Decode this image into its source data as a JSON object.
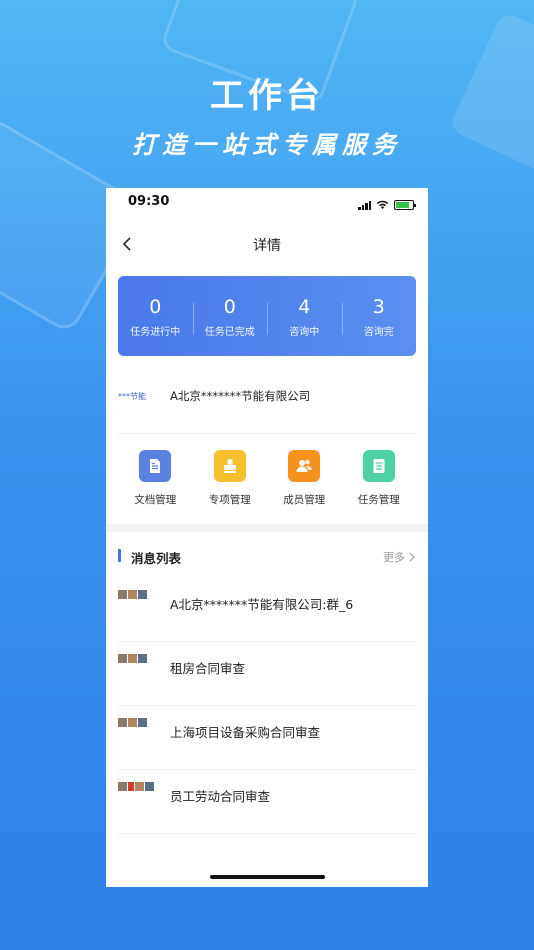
{
  "hero": {
    "title": "工作台",
    "subtitle": "打造一站式专属服务"
  },
  "statusbar": {
    "time": "09:30"
  },
  "navbar": {
    "title": "详情"
  },
  "stats": [
    {
      "value": "0",
      "label": "任务进行中"
    },
    {
      "value": "0",
      "label": "任务已完成"
    },
    {
      "value": "4",
      "label": "咨询中"
    },
    {
      "value": "3",
      "label": "咨询完"
    }
  ],
  "company": {
    "logo_text": "***节能",
    "name": "A北京*******节能有限公司"
  },
  "menu": [
    {
      "label": "文档管理",
      "icon": "document-icon",
      "color": "#5b82e3"
    },
    {
      "label": "专项管理",
      "icon": "stamp-icon",
      "color": "#f6bf2e"
    },
    {
      "label": "成员管理",
      "icon": "members-icon",
      "color": "#f6931d"
    },
    {
      "label": "任务管理",
      "icon": "task-list-icon",
      "color": "#4fd2a3"
    }
  ],
  "messages": {
    "title": "消息列表",
    "more": "更多",
    "items": [
      {
        "text": "A北京*******节能有限公司:群_6"
      },
      {
        "text": "租房合同审查"
      },
      {
        "text": "上海项目设备采购合同审查"
      },
      {
        "text": "员工劳动合同审查"
      }
    ]
  },
  "colors": {
    "accent": "#4a78ea",
    "background_top": "#52b6f3",
    "background_bottom": "#2f7fe9"
  }
}
